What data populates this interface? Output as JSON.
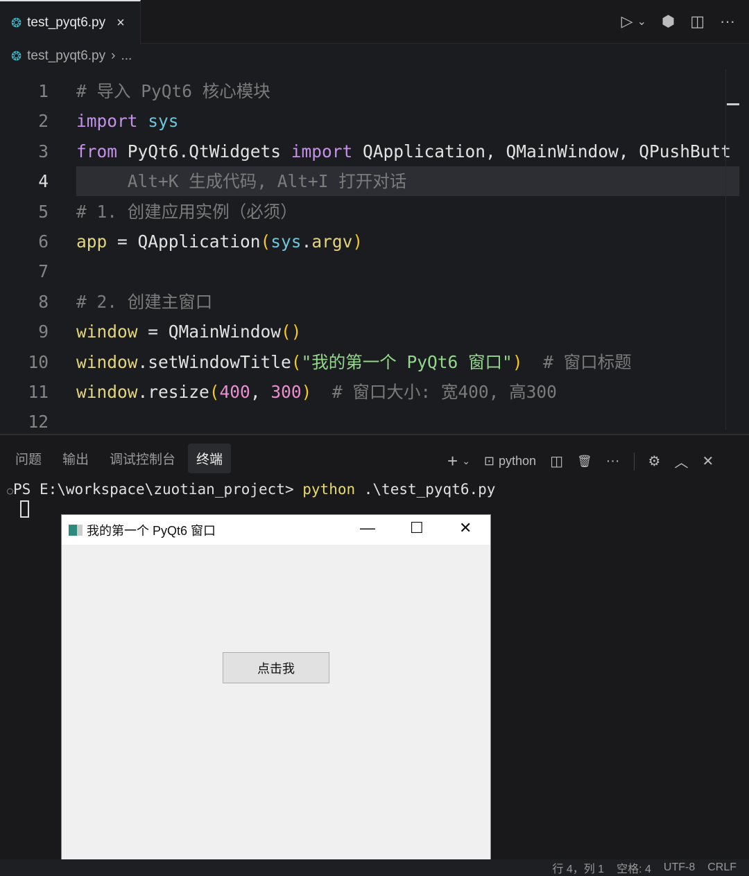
{
  "tab": {
    "filename": "test_pyqt6.py",
    "close": "×"
  },
  "breadcrumb": {
    "file": "test_pyqt6.py",
    "sep": "›",
    "more": "..."
  },
  "actions": {
    "run": "▷",
    "dropdown": "⌄",
    "ext": "⬢",
    "split": "◫",
    "more": "···"
  },
  "editor": {
    "current_line": 4,
    "lines": [
      [
        [
          "cm",
          "# 导入 PyQt6 核心模块"
        ]
      ],
      [
        [
          "kw",
          "import"
        ],
        [
          "df",
          " "
        ],
        [
          "mod",
          "sys"
        ]
      ],
      [
        [
          "kw",
          "from"
        ],
        [
          "df",
          " PyQt6.QtWidgets "
        ],
        [
          "kw",
          "import"
        ],
        [
          "df",
          " QApplication, QMainWindow, QPushButt"
        ]
      ],
      [
        [
          "gh",
          "     Alt+K 生成代码, Alt+I 打开对话"
        ]
      ],
      [
        [
          "cm",
          "# 1. 创建应用实例（必须）"
        ]
      ],
      [
        [
          "var",
          "app"
        ],
        [
          "df",
          " = QApplication"
        ],
        [
          "pa",
          "("
        ],
        [
          "mod",
          "sys"
        ],
        [
          "df",
          "."
        ],
        [
          "var",
          "argv"
        ],
        [
          "pa",
          ")"
        ]
      ],
      [],
      [
        [
          "cm",
          "# 2. 创建主窗口"
        ]
      ],
      [
        [
          "var",
          "window"
        ],
        [
          "df",
          " = QMainWindow"
        ],
        [
          "pa",
          "()"
        ]
      ],
      [
        [
          "var",
          "window"
        ],
        [
          "df",
          ".setWindowTitle"
        ],
        [
          "pa",
          "("
        ],
        [
          "st",
          "\"我的第一个 PyQt6 窗口\""
        ],
        [
          "pa",
          ")"
        ],
        [
          "cm",
          "  # 窗口标题"
        ]
      ],
      [
        [
          "var",
          "window"
        ],
        [
          "df",
          ".resize"
        ],
        [
          "pa",
          "("
        ],
        [
          "nu",
          "400"
        ],
        [
          "df",
          ", "
        ],
        [
          "nu",
          "300"
        ],
        [
          "pa",
          ")"
        ],
        [
          "cm",
          "  # 窗口大小: 宽400, 高300"
        ]
      ],
      []
    ]
  },
  "panel": {
    "tabs": [
      "问题",
      "输出",
      "调试控制台",
      "终端"
    ],
    "active": 3,
    "add": "+",
    "dropdown": "⌄",
    "terminal_icon": "⊡",
    "shell": "python",
    "split": "◫",
    "trash": "🗑",
    "more": "···",
    "settings": "⚙",
    "maximize": "︿",
    "close": "✕"
  },
  "terminal": {
    "dot": "○",
    "prompt": "PS E:\\workspace\\zuotian_project> ",
    "cmd": "python",
    "args": " .\\test_pyqt6.py"
  },
  "qt_window": {
    "title": "我的第一个 PyQt6 窗口",
    "minimize": "—",
    "maximize": "☐",
    "close": "✕",
    "button": "点击我"
  },
  "status": {
    "position": "行 4，列 1",
    "spaces": "空格: 4",
    "encoding": "UTF-8",
    "eol": "CRLF"
  }
}
